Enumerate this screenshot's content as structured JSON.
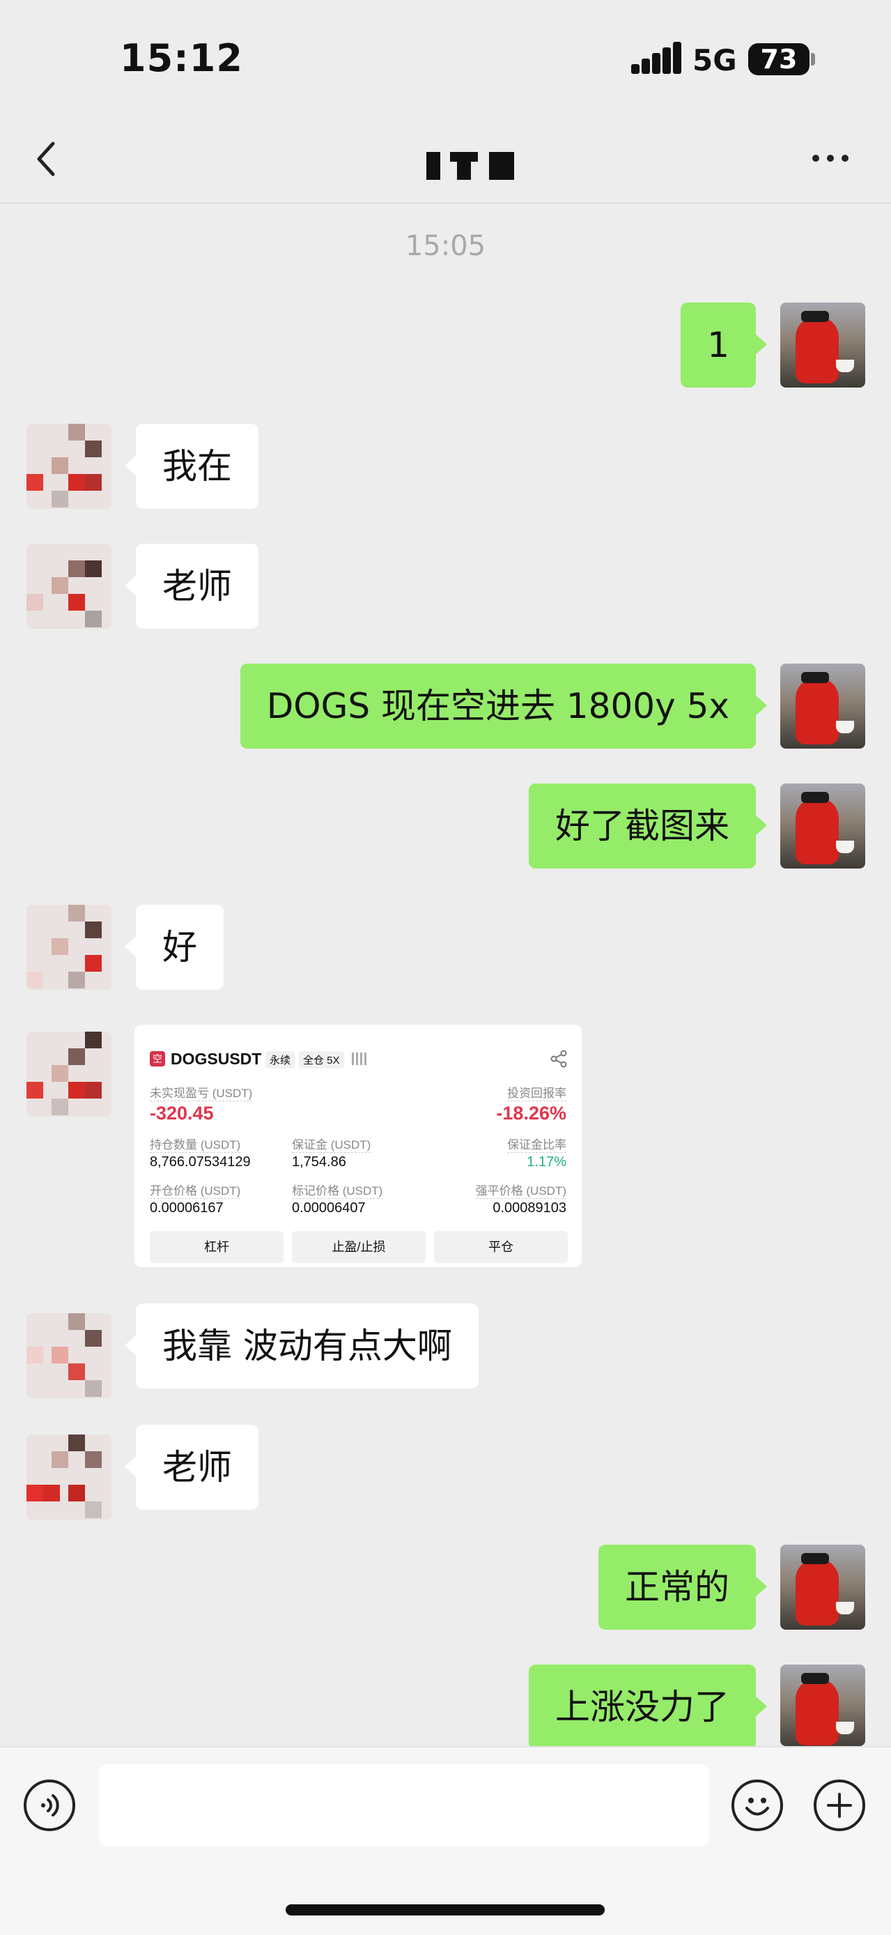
{
  "status_bar": {
    "time": "15:12",
    "network": "5G",
    "battery": "73"
  },
  "header": {
    "back_icon": "chevron-left-icon",
    "more_icon": "ellipsis-icon"
  },
  "chat": {
    "timestamp": "15:05",
    "messages": [
      {
        "sender": "me",
        "text": "1"
      },
      {
        "sender": "other",
        "text": "我在"
      },
      {
        "sender": "other",
        "text": "老师"
      },
      {
        "sender": "me",
        "text": "DOGS 现在空进去 1800y 5x"
      },
      {
        "sender": "me",
        "text": "好了截图来"
      },
      {
        "sender": "other",
        "text": "好"
      },
      {
        "sender": "other",
        "type": "image"
      },
      {
        "sender": "other",
        "text": "我靠 波动有点大啊"
      },
      {
        "sender": "other",
        "text": "老师"
      },
      {
        "sender": "me",
        "text": "正常的"
      },
      {
        "sender": "me",
        "text": "上涨没力了"
      }
    ]
  },
  "position_card": {
    "logo": "空",
    "pair": "DOGSUSDT",
    "tag_perpetual": "永续",
    "tag_margin": "全仓 5X",
    "unrealized_pnl_label": "未实现盈亏 (USDT)",
    "unrealized_pnl": "-320.45",
    "roi_label": "投资回报率",
    "roi": "-18.26%",
    "position_size_label": "持仓数量 (USDT)",
    "position_size": "8,766.07534129",
    "margin_label": "保证金 (USDT)",
    "margin": "1,754.86",
    "margin_ratio_label": "保证金比率",
    "margin_ratio": "1.17%",
    "entry_price_label": "开仓价格 (USDT)",
    "entry_price": "0.00006167",
    "mark_price_label": "标记价格 (USDT)",
    "mark_price": "0.00006407",
    "liq_price_label": "强平价格 (USDT)",
    "liq_price": "0.00089103",
    "buttons": [
      "杠杆",
      "止盈/止损",
      "平仓"
    ]
  },
  "input_bar": {
    "voice_icon": "voice-icon",
    "emoji_icon": "emoji-icon",
    "plus_icon": "plus-icon",
    "input_value": ""
  }
}
